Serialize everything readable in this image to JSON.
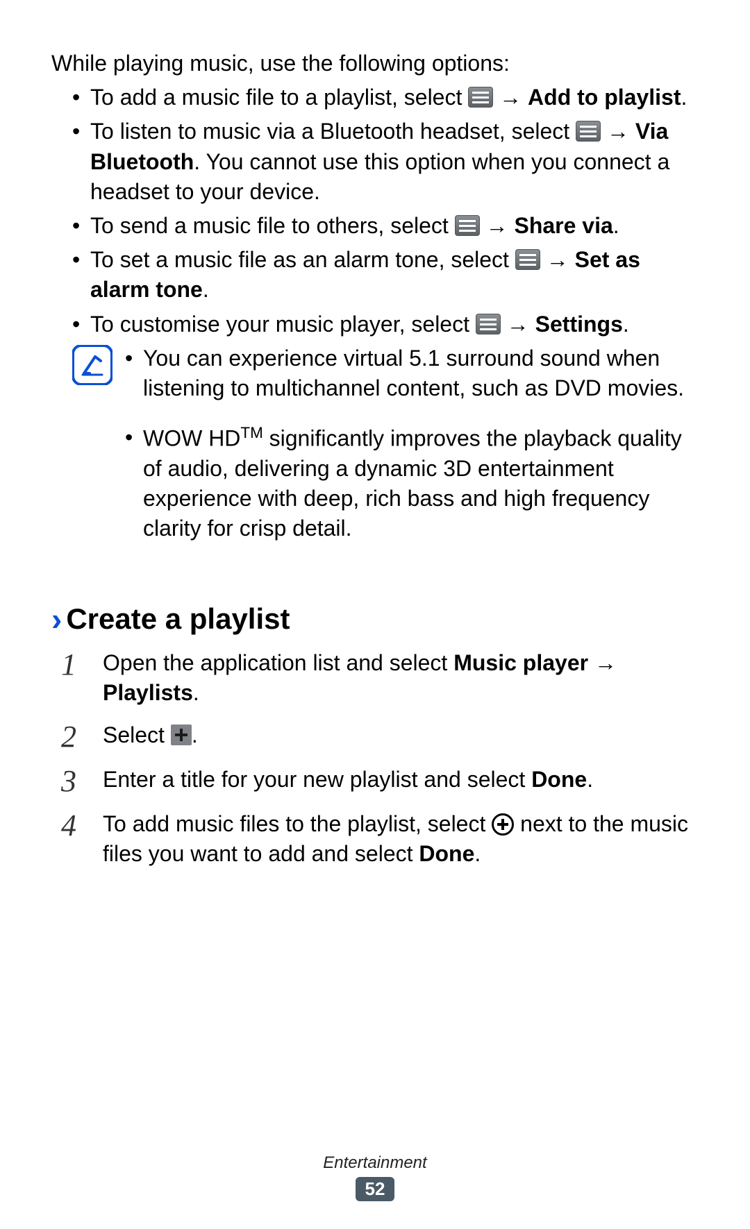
{
  "intro": "While playing music, use the following options:",
  "bullets": {
    "b1": {
      "pre": "To add a music file to a playlist, select ",
      "post_bold": "Add to playlist",
      "post_tail": "."
    },
    "b2": {
      "pre": "To listen to music via a Bluetooth headset, select ",
      "bold1": "Via Bluetooth",
      "tail": ". You cannot use this option when you connect a headset to your device."
    },
    "b3": {
      "pre": "To send a music file to others, select ",
      "bold": "Share via",
      "tail": "."
    },
    "b4": {
      "pre": "To set a music file as an alarm tone, select ",
      "bold": "Set as alarm tone",
      "tail": "."
    },
    "b5": {
      "pre": "To customise your music player, select ",
      "bold": "Settings",
      "tail": "."
    }
  },
  "arrow": "→",
  "note": {
    "n1": "You can experience virtual 5.1 surround sound when listening to multichannel content, such as DVD movies.",
    "n2_pre": "WOW HD",
    "n2_tm": "TM",
    "n2_post": " significantly improves the playback quality of audio, delivering a dynamic 3D entertainment experience with deep, rich bass and high frequency clarity for crisp detail."
  },
  "section": {
    "chevron": "›",
    "title": "Create a playlist"
  },
  "steps": {
    "s1": {
      "pre": "Open the application list and select ",
      "b1": "Music player",
      "arrow": " → ",
      "b2": "Playlists",
      "tail": "."
    },
    "s2": {
      "pre": "Select ",
      "tail": "."
    },
    "s3": {
      "pre": "Enter a title for your new playlist and select ",
      "b1": "Done",
      "tail": "."
    },
    "s4": {
      "pre": "To add music files to the playlist, select ",
      "mid": " next to the music files you want to add and select ",
      "b1": "Done",
      "tail": "."
    }
  },
  "footer": {
    "section": "Entertainment",
    "page": "52"
  }
}
